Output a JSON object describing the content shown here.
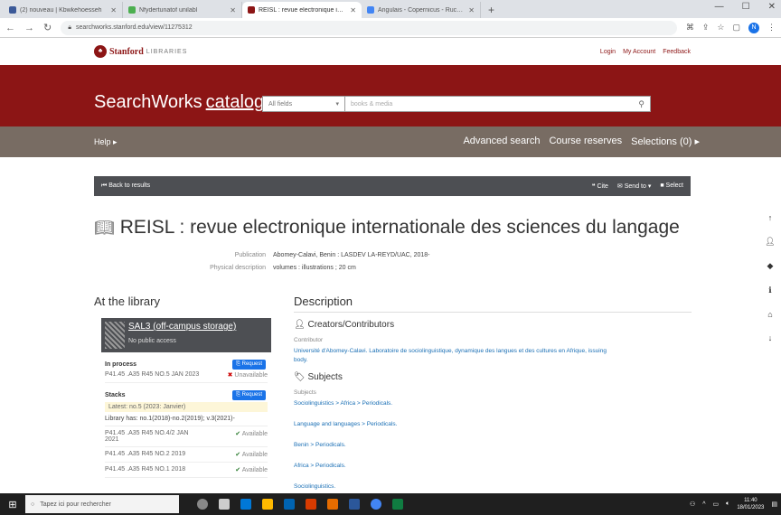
{
  "browser": {
    "tabs": [
      {
        "title": "(2) nouveau | Kbwkehoesseh",
        "color": "#3b5998",
        "active": false
      },
      {
        "title": "Nfydertunatof unilabl",
        "color": "#4caf50",
        "active": false
      },
      {
        "title": "REISL : revue electronique inter",
        "color": "#8c1515",
        "active": true
      },
      {
        "title": "Angulais - Copernicus - Rucker",
        "color": "#4285f4",
        "active": false
      }
    ],
    "new_tab": "+",
    "url": "searchworks.stanford.edu/view/11275312"
  },
  "stanford": {
    "logo_word": "Stanford",
    "logo_sub": "LIBRARIES",
    "links": [
      "Login",
      "My Account",
      "Feedback"
    ]
  },
  "masthead": {
    "brand": "SearchWorks",
    "brand_catalog": "catalog",
    "brand_caret": "▾",
    "search_select": "All fields",
    "search_placeholder": "books & media"
  },
  "nav": {
    "help": "Help",
    "right": [
      "Advanced search",
      "Course reserves",
      "Selections (0)"
    ]
  },
  "toolbar": {
    "back": "Back to results",
    "cite": "Cite",
    "send": "Send to",
    "select": "Select"
  },
  "record": {
    "title": "REISL : revue electronique internationale des sciences du langage",
    "publication_label": "Publication",
    "publication": "Abomey-Calavi, Benin : LASDEV LA-REYD/UAC, 2018-",
    "physical_label": "Physical description",
    "physical": "volumes : illustrations ; 20 cm"
  },
  "library": {
    "heading": "At the library",
    "location": "SAL3 (off-campus storage)",
    "location_sub": "No public access",
    "in_process": {
      "heading": "In process",
      "request": "Request",
      "callnumber": "P41.45 .A35 R45 NO.5 JAN 2023",
      "status": "Unavailable"
    },
    "stacks": {
      "heading": "Stacks",
      "request": "Request",
      "latest": "Latest: no.5 (2023: Janvier)",
      "holdings": "Library has: no.1(2018)-no.2(2019); v.3(2021)-",
      "items": [
        {
          "callnumber": "P41.45 .A35 R45 NO.4/2 JAN 2021",
          "status": "Available"
        },
        {
          "callnumber": "P41.45 .A35 R45 NO.2 2019",
          "status": "Available"
        },
        {
          "callnumber": "P41.45 .A35 R45 NO.1 2018",
          "status": "Available"
        }
      ]
    }
  },
  "description": {
    "heading": "Description",
    "creators_heading": "Creators/Contributors",
    "contributor_label": "Contributor",
    "contributor": "Université d'Abomey-Calavi. Laboratoire de sociolinguistique, dynamique des langues et des cultures en Afrique, issuing body.",
    "subjects_heading": "Subjects",
    "subjects_label": "Subjects",
    "subjects": [
      "Sociolinguistics > Africa > Periodicals.",
      "Language and languages > Periodicals.",
      "Benin > Periodicals.",
      "Africa > Periodicals.",
      "Sociolinguistics."
    ]
  },
  "taskbar": {
    "search_placeholder": "Tapez ici pour rechercher",
    "time": "11:40",
    "date": "18/01/2023"
  }
}
